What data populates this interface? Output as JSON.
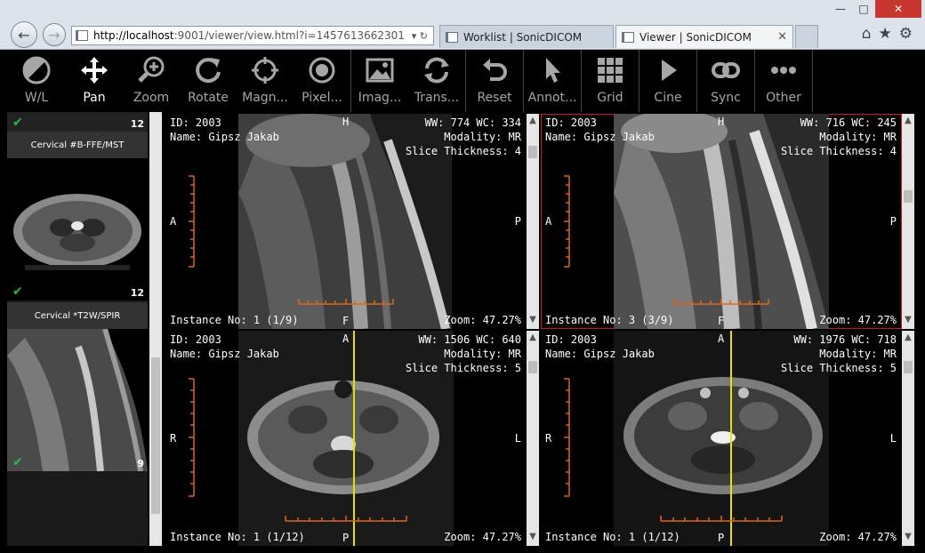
{
  "browser": {
    "url_host": "http://localhost",
    "url_rest": ":9001/viewer/view.html?i=1457613662301",
    "tabs": [
      {
        "label": "Worklist | SonicDICOM"
      },
      {
        "label": "Viewer | SonicDICOM"
      }
    ],
    "minimize": "—",
    "maximize": "□",
    "close": "✕",
    "back_glyph": "←",
    "fwd_glyph": "→",
    "addr_icons": "▾ ↻",
    "tab_close": "✕"
  },
  "toolbar": {
    "tools": [
      {
        "label": "W/L",
        "icon": "contrast-icon"
      },
      {
        "label": "Pan",
        "icon": "move-icon"
      },
      {
        "label": "Zoom",
        "icon": "zoom-icon"
      },
      {
        "label": "Rotate",
        "icon": "rotate-icon"
      },
      {
        "label": "Magn...",
        "icon": "crosshair-icon"
      },
      {
        "label": "Pixel...",
        "icon": "target-icon"
      },
      {
        "label": "Imag...",
        "icon": "image-icon"
      },
      {
        "label": "Trans...",
        "icon": "transform-icon"
      },
      {
        "label": "Reset",
        "icon": "undo-icon"
      },
      {
        "label": "Annot...",
        "icon": "pointer-icon"
      },
      {
        "label": "Grid",
        "icon": "grid-icon"
      },
      {
        "label": "Cine",
        "icon": "play-icon"
      },
      {
        "label": "Sync",
        "icon": "link-icon"
      },
      {
        "label": "Other",
        "icon": "more-icon"
      }
    ],
    "active": "Pan"
  },
  "thumbnails": {
    "series": [
      {
        "title": "",
        "count": "12"
      },
      {
        "title": "Cervical #B-FFE/MST",
        "count": "12"
      },
      {
        "title": "Cervical *T2W/SPIR",
        "count": "9"
      }
    ]
  },
  "viewports": [
    {
      "id": "ID: 2003",
      "name": "Name: Gipsz Jakab",
      "wwwc": "WW: 774 WC: 334",
      "modality": "Modality: MR",
      "thickness": "Slice Thickness: 4",
      "instance": "Instance No: 1 (1/9)",
      "zoom": "Zoom: 47.27%",
      "top": "H",
      "bottom": "F",
      "left": "A",
      "right": "P"
    },
    {
      "id": "ID: 2003",
      "name": "Name: Gipsz Jakab",
      "wwwc": "WW: 716 WC: 245",
      "modality": "Modality: MR",
      "thickness": "Slice Thickness: 4",
      "instance": "Instance No: 3 (3/9)",
      "zoom": "Zoom: 47.27%",
      "top": "H",
      "bottom": "F",
      "left": "A",
      "right": "P"
    },
    {
      "id": "ID: 2003",
      "name": "Name: Gipsz Jakab",
      "wwwc": "WW: 1506 WC: 640",
      "modality": "Modality: MR",
      "thickness": "Slice Thickness: 5",
      "instance": "Instance No: 1 (1/12)",
      "zoom": "Zoom: 47.27%",
      "top": "A",
      "bottom": "P",
      "left": "R",
      "right": "L"
    },
    {
      "id": "ID: 2003",
      "name": "Name: Gipsz Jakab",
      "wwwc": "WW: 1976 WC: 718",
      "modality": "Modality: MR",
      "thickness": "Slice Thickness: 5",
      "instance": "Instance No: 1 (1/12)",
      "zoom": "Zoom: 47.27%",
      "top": "A",
      "bottom": "P",
      "left": "R",
      "right": "L"
    }
  ],
  "colors": {
    "accent_orange": "#d9661f",
    "selected_border": "#c21d2b",
    "sync_line": "#e8e000",
    "check_green": "#2db84b"
  }
}
